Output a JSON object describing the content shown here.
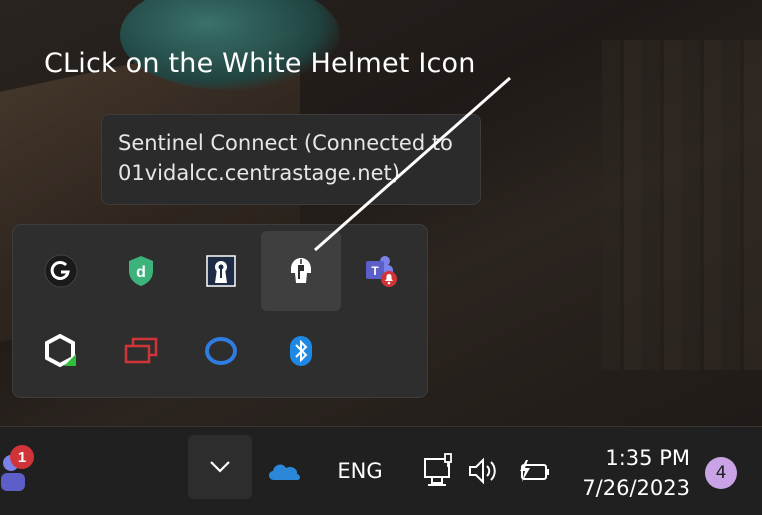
{
  "instruction": {
    "text": "CLick on the White Helmet Icon"
  },
  "tooltip": {
    "line1": "Sentinel Connect (Connected to",
    "line2": "01vidalcc.centrastage.net)"
  },
  "tray_flyout": {
    "icons": [
      {
        "name": "logitech-g-hub-icon",
        "color": "#1a1a1a"
      },
      {
        "name": "datto-shield-icon",
        "color": "#3bb37a"
      },
      {
        "name": "keyhole-lock-icon",
        "color": "#1e2b45"
      },
      {
        "name": "sentinel-helmet-icon",
        "color": "#ffffff"
      },
      {
        "name": "teams-notification-icon",
        "color": "#5b5fc7"
      },
      {
        "name": "hexagon-agent-icon",
        "color": "#ffffff"
      },
      {
        "name": "red-windows-icon",
        "color": "#d13438"
      },
      {
        "name": "blue-ring-icon",
        "color": "#2f7de1"
      },
      {
        "name": "bluetooth-icon",
        "color": "#1e88e5"
      }
    ]
  },
  "taskbar": {
    "teams_badge": "1",
    "language": "ENG",
    "time": "1:35 PM",
    "date": "7/26/2023",
    "notification_count": "4",
    "onedrive_color": "#2b88d8"
  }
}
